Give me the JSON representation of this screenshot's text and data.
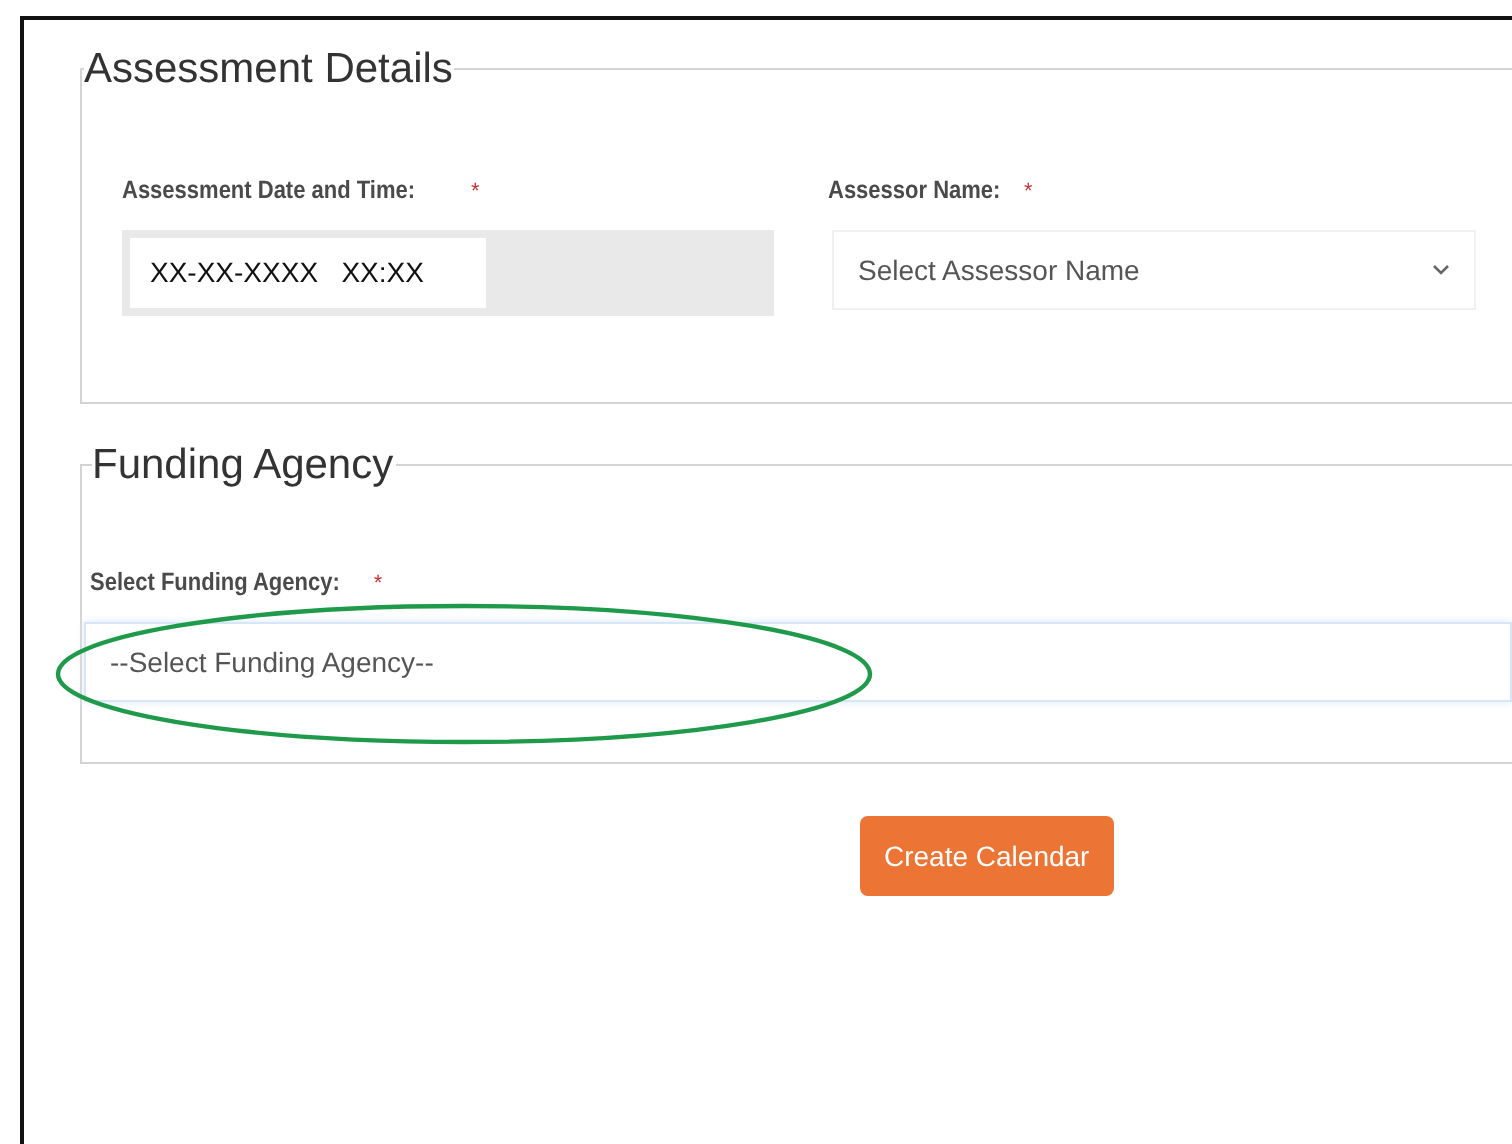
{
  "sections": [
    {
      "legend": "Assessment Details",
      "fields": [
        {
          "kind": "datetime",
          "label": "Assessment Date and Time:",
          "required_mark": "*",
          "value": "XX-XX-XXXX   XX:XX"
        },
        {
          "kind": "select",
          "label": "Assessor Name:",
          "required_mark": "*",
          "placeholder": "Select Assessor Name"
        }
      ]
    },
    {
      "legend": "Funding Agency",
      "fields": [
        {
          "kind": "select-wide",
          "label": "Select Funding Agency:",
          "required_mark": "*",
          "placeholder": "--Select Funding Agency--",
          "highlighted": true
        }
      ]
    }
  ],
  "button": {
    "label": "Create Calendar"
  }
}
